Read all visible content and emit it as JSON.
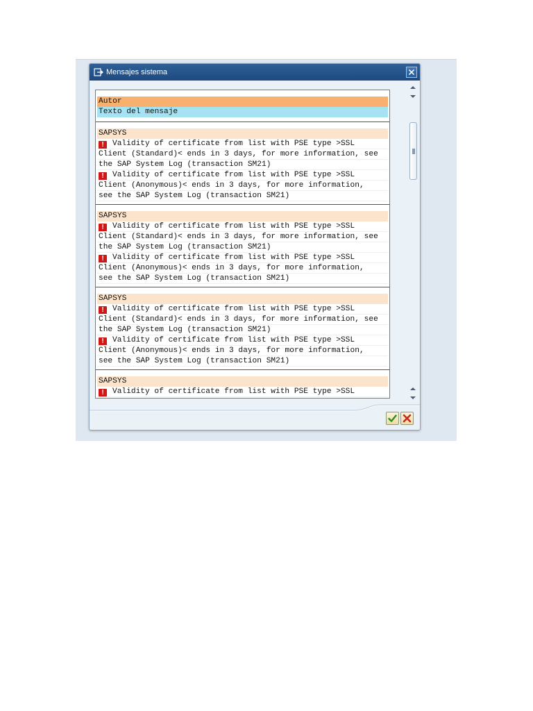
{
  "dialog": {
    "title": "Mensajes sistema",
    "icons": {
      "title": "system-message-icon",
      "close": "close-icon",
      "ok": "checkmark-icon",
      "cancel": "cancel-x-icon"
    }
  },
  "list": {
    "header": {
      "author_label": "Autor",
      "text_label": "Texto del mensaje"
    },
    "blocks": [
      {
        "author": "SAPSYS",
        "messages": [
          {
            "icon": "error-icon",
            "lines": [
              "Validity of certificate from list with PSE type >SSL",
              "Client (Standard)< ends in 3 days, for more information, see",
              "the SAP System Log (transaction SM21)"
            ]
          },
          {
            "icon": "error-icon",
            "lines": [
              "Validity of certificate from list with PSE type >SSL",
              "Client (Anonymous)< ends in 3 days, for more information,",
              "see the SAP System Log (transaction SM21)"
            ]
          }
        ]
      },
      {
        "author": "SAPSYS",
        "messages": [
          {
            "icon": "error-icon",
            "lines": [
              "Validity of certificate from list with PSE type >SSL",
              "Client (Standard)< ends in 3 days, for more information, see",
              "the SAP System Log (transaction SM21)"
            ]
          },
          {
            "icon": "error-icon",
            "lines": [
              "Validity of certificate from list with PSE type >SSL",
              "Client (Anonymous)< ends in 3 days, for more information,",
              "see the SAP System Log (transaction SM21)"
            ]
          }
        ]
      },
      {
        "author": "SAPSYS",
        "messages": [
          {
            "icon": "error-icon",
            "lines": [
              "Validity of certificate from list with PSE type >SSL",
              "Client (Standard)< ends in 3 days, for more information, see",
              "the SAP System Log (transaction SM21)"
            ]
          },
          {
            "icon": "error-icon",
            "lines": [
              "Validity of certificate from list with PSE type >SSL",
              "Client (Anonymous)< ends in 3 days, for more information,",
              "see the SAP System Log (transaction SM21)"
            ]
          }
        ]
      },
      {
        "author": "SAPSYS",
        "messages": [
          {
            "icon": "error-icon",
            "lines": [
              "Validity of certificate from list with PSE type >SSL"
            ]
          }
        ]
      }
    ]
  },
  "colors": {
    "title_bar": "#1d4a80",
    "author_header": "#f8b06f",
    "text_header": "#a6e3f2",
    "author_row": "#fbe3cc",
    "error_icon": "#d11616"
  }
}
